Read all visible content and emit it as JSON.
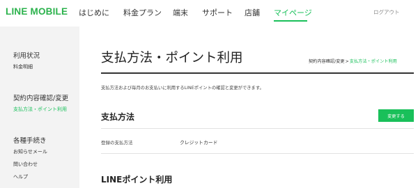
{
  "header": {
    "logo": "LINE MOBILE",
    "nav": [
      {
        "label": "はじめに"
      },
      {
        "label": "料金プラン"
      },
      {
        "label": "端末"
      },
      {
        "label": "サポート"
      },
      {
        "label": "店舗"
      },
      {
        "label": "マイページ",
        "active": true
      }
    ],
    "logout": "ログアウト"
  },
  "sidebar": {
    "groups": [
      {
        "heading": "利用状況",
        "items": [
          "料金明細"
        ]
      },
      {
        "heading": "契約内容確認/変更",
        "items": [
          "支払方法・ポイント利用"
        ]
      },
      {
        "heading": "各種手続き",
        "items": [
          "お知らせメール",
          "問い合わせ",
          "ヘルプ"
        ]
      }
    ]
  },
  "main": {
    "title": "支払方法・ポイント利用",
    "breadcrumb": {
      "parent": "契約内容確認/変更",
      "separator": ">",
      "current": "支払方法・ポイント利用"
    },
    "description": "支払方法および毎月のお支払いに利用するLINEポイントの確認と変更ができます。",
    "payment_section": {
      "title": "支払方法",
      "change_button": "変更する",
      "row_label": "登録の支払方法",
      "row_value": "クレジットカード"
    },
    "points_section": {
      "title": "LINEポイント利用"
    }
  },
  "colors": {
    "brand_green": "#19c05a",
    "logo_green": "#2bb24c",
    "sidebar_bg": "#f3f3f3"
  }
}
